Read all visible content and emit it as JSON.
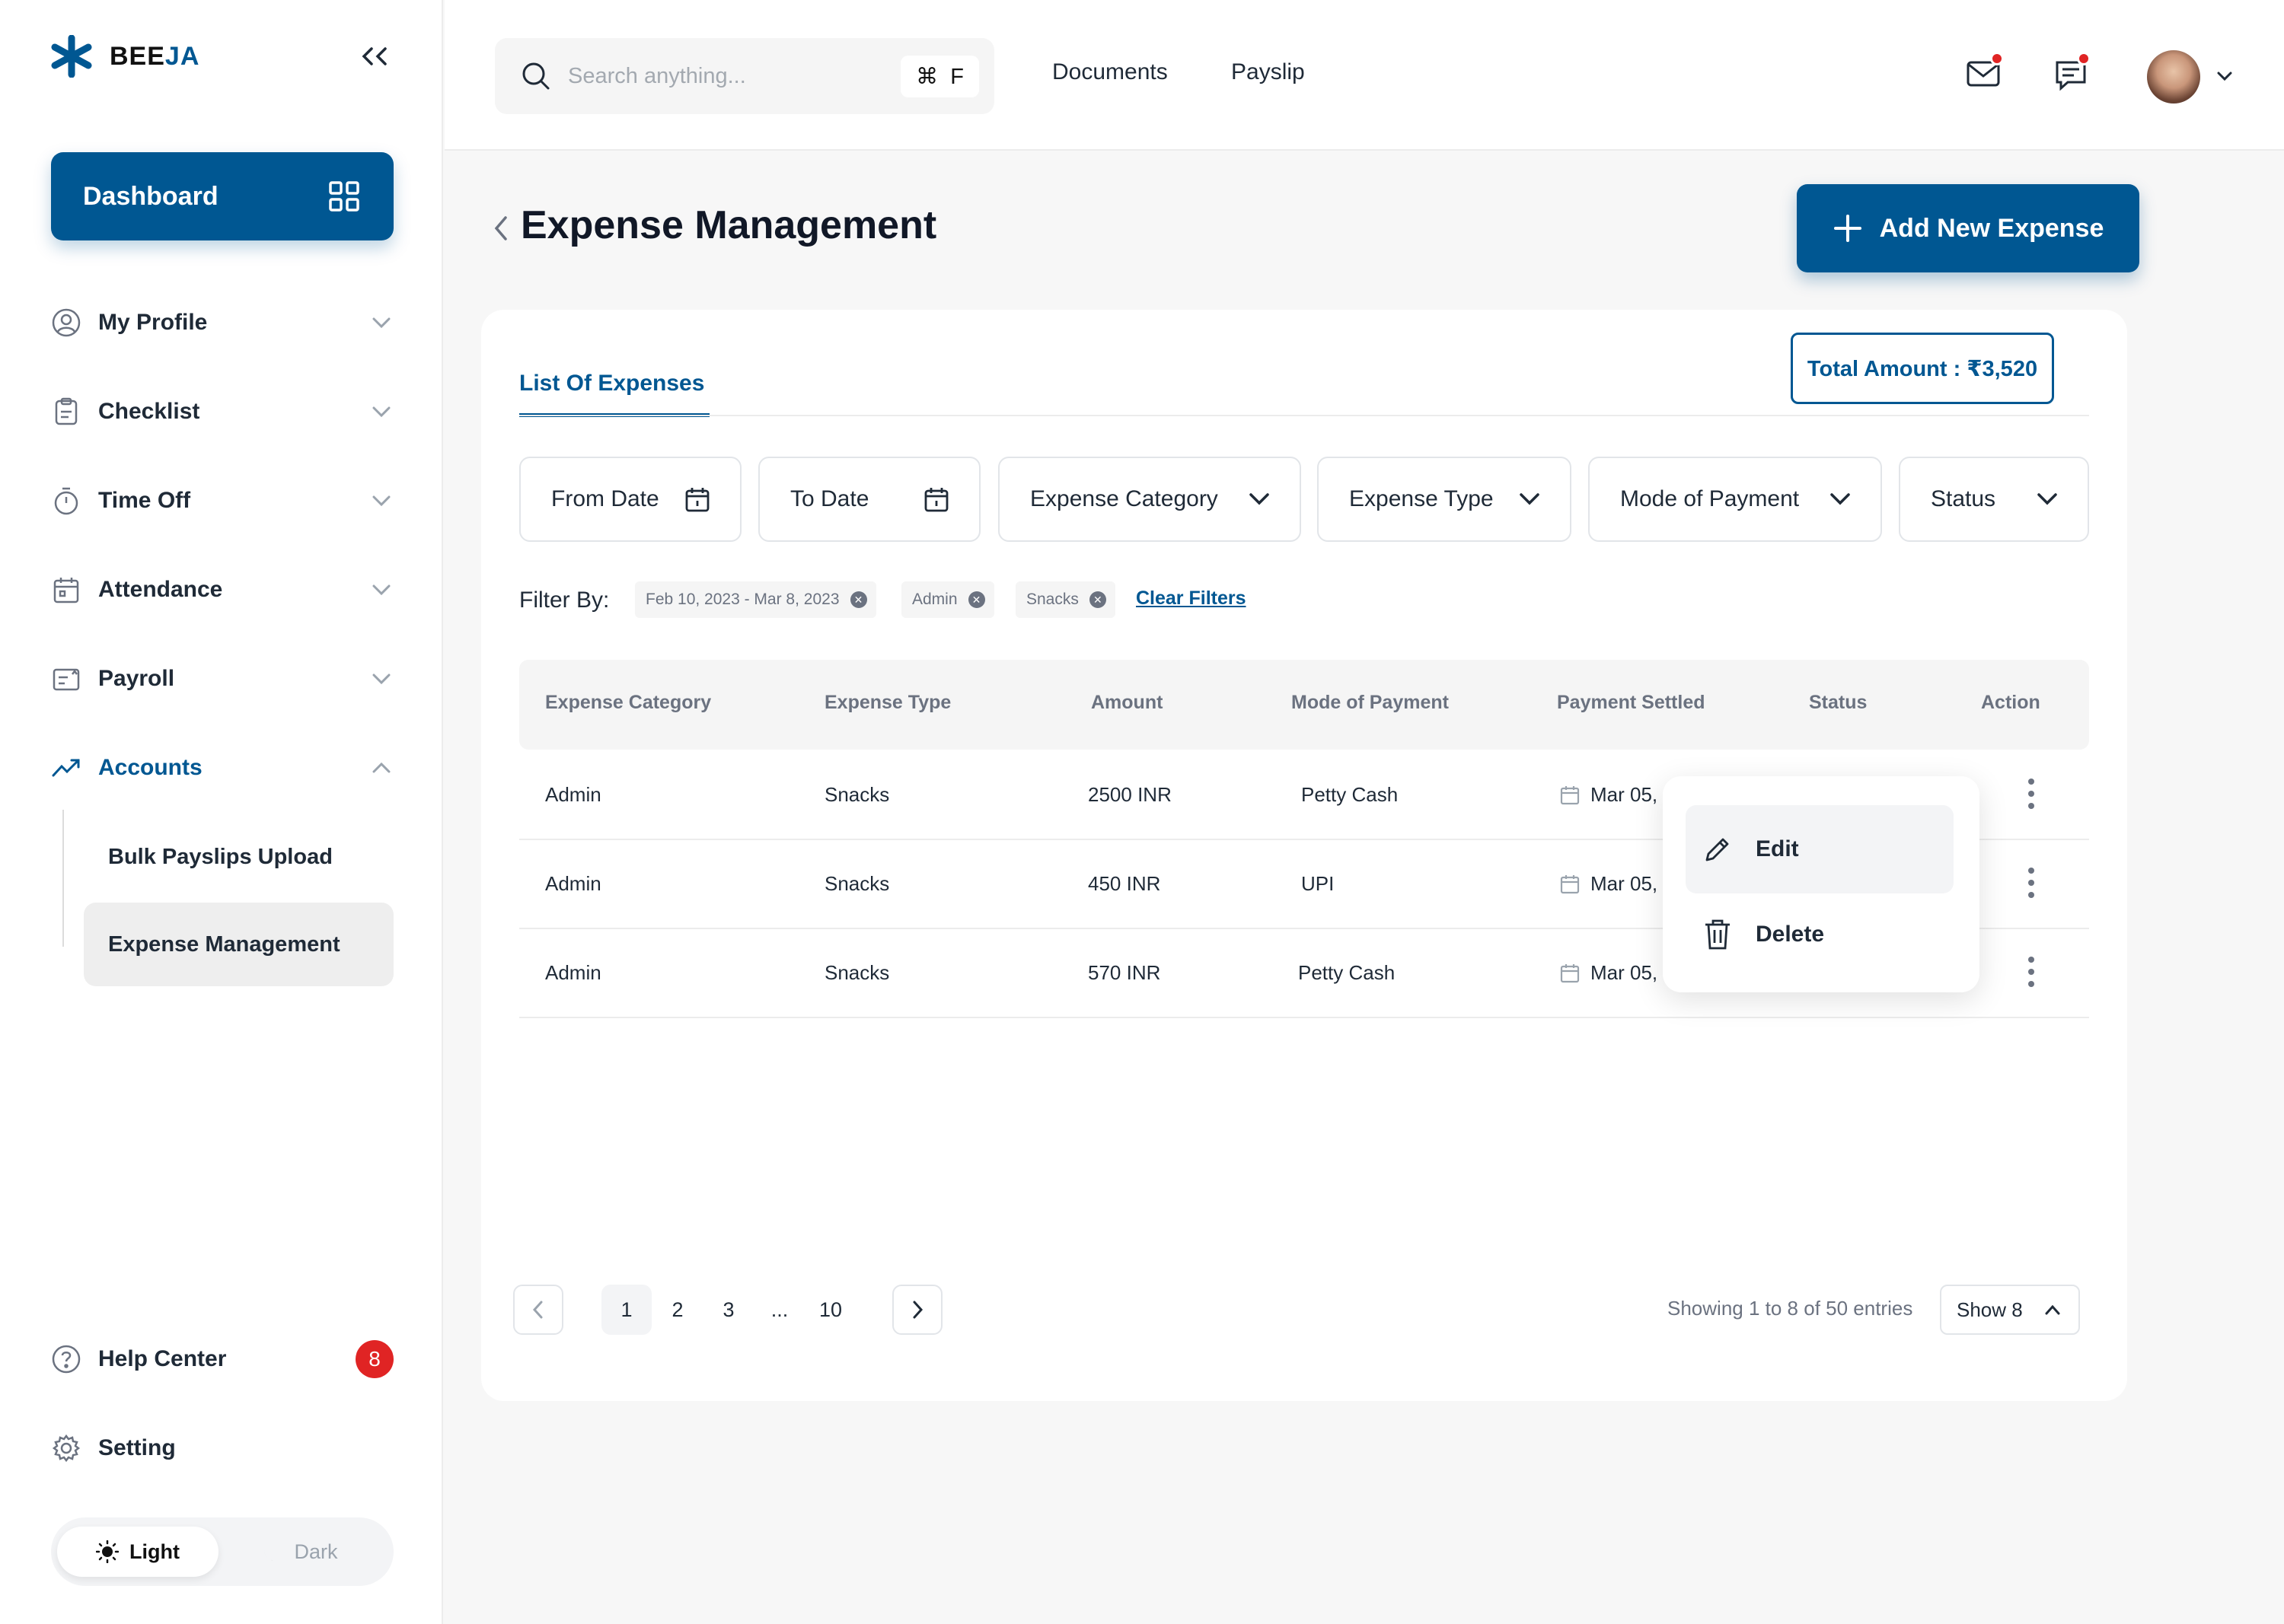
{
  "brand": {
    "prefix": "BEE",
    "suffix": "JA"
  },
  "colors": {
    "primary": "#005792",
    "danger": "#e02424"
  },
  "sidebar": {
    "collapse_icon": "double-chevron-left-icon",
    "dashboard_label": "Dashboard",
    "items": [
      {
        "label": "My Profile",
        "icon": "user-circle-icon"
      },
      {
        "label": "Checklist",
        "icon": "clipboard-icon"
      },
      {
        "label": "Time Off",
        "icon": "stopwatch-icon"
      },
      {
        "label": "Attendance",
        "icon": "calendar-icon"
      },
      {
        "label": "Payroll",
        "icon": "payroll-icon"
      },
      {
        "label": "Accounts",
        "icon": "trending-up-icon"
      }
    ],
    "sub_items": [
      {
        "label": "Bulk Payslips Upload"
      },
      {
        "label": "Expense Management"
      }
    ],
    "help_label": "Help Center",
    "help_badge": "8",
    "setting_label": "Setting",
    "theme": {
      "light": "Light",
      "dark": "Dark"
    }
  },
  "topbar": {
    "search_placeholder": "Search anything...",
    "shortcut_symbol": "⌘",
    "shortcut_key": "F",
    "links": [
      "Documents",
      "Payslip"
    ]
  },
  "main": {
    "title": "Expense Management",
    "add_button": "Add New Expense",
    "tab": "List Of Expenses",
    "total_amount": "Total Amount : ₹3,520",
    "filters": [
      "From Date",
      "To Date",
      "Expense Category",
      "Expense Type",
      "Mode of Payment",
      "Status"
    ],
    "filter_by_label": "Filter By:",
    "chips": [
      "Feb 10, 2023 - Mar 8, 2023",
      "Admin",
      "Snacks"
    ],
    "clear_filters": "Clear Filters",
    "table": {
      "columns": [
        "Expense Category",
        "Expense Type",
        "Amount",
        "Mode of Payment",
        "Payment Settled",
        "Status",
        "Action"
      ],
      "rows": [
        {
          "category": "Admin",
          "type": "Snacks",
          "amount": "2500 INR",
          "mode": "Petty Cash",
          "settled": "Mar 05, 2"
        },
        {
          "category": "Admin",
          "type": "Snacks",
          "amount": "450 INR",
          "mode": "UPI",
          "settled": "Mar 05,"
        },
        {
          "category": "Admin",
          "type": "Snacks",
          "amount": "570 INR",
          "mode": "Petty Cash",
          "settled": "Mar 05,"
        }
      ]
    },
    "row_menu": {
      "edit": "Edit",
      "delete": "Delete"
    },
    "pagination": {
      "pages": [
        "1",
        "2",
        "3",
        "...",
        "10"
      ],
      "current": "1"
    },
    "entries_text": "Showing 1 to 8 of 50 entries",
    "show_select": "Show 8"
  }
}
